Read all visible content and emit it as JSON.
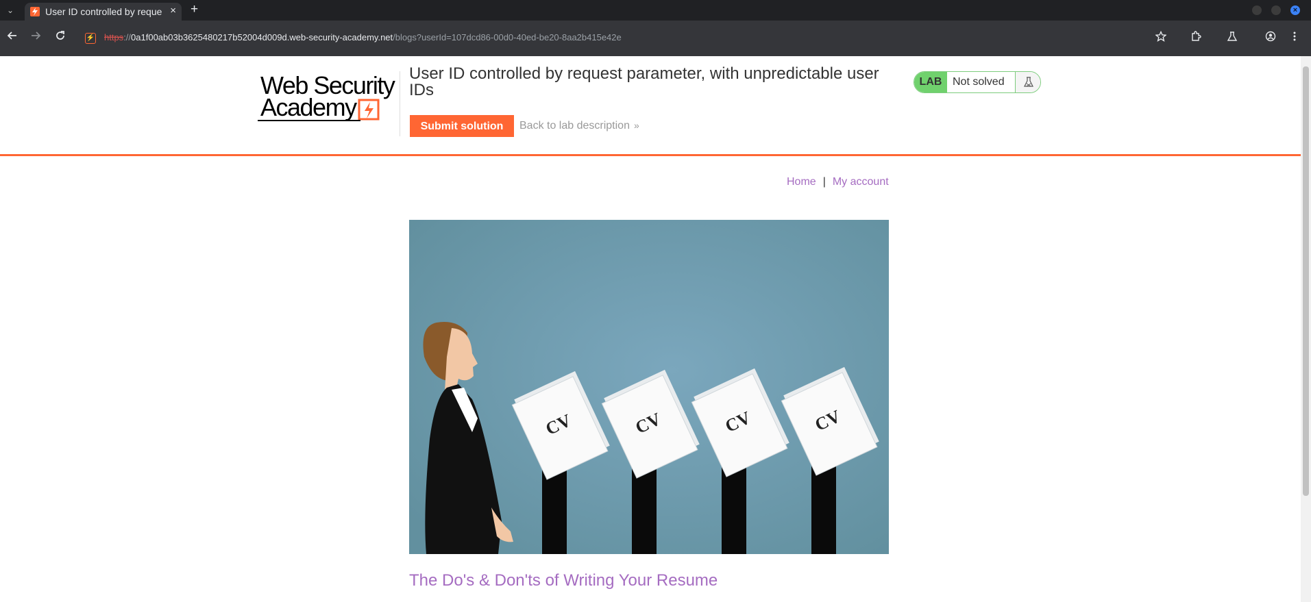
{
  "browser": {
    "tab": {
      "title": "User ID controlled by request parameter, with unpredictable user IDs",
      "close_glyph": "×"
    },
    "new_tab_glyph": "+",
    "tab_list_glyph": "⌄",
    "url": {
      "scheme": "https",
      "separator": "://",
      "host": "0a1f00ab03b3625480217b52004d009d.web-security-academy.net",
      "path": "/blogs?userId=107dcd86-00d0-40ed-be20-8aa2b415e42e"
    },
    "icons": [
      "back-icon",
      "forward-icon",
      "reload-icon",
      "bookmark-star-icon",
      "extensions-icon",
      "labs-flask-icon",
      "profile-icon",
      "menu-icon"
    ],
    "window_close_glyph": "×"
  },
  "header": {
    "logo": {
      "line1": "Web Security",
      "line2": "Academy"
    },
    "lab_title": "User ID controlled by request parameter, with unpredictable user IDs",
    "submit_label": "Submit solution",
    "back_label": "Back to lab description",
    "back_chevron": "»",
    "status": {
      "badge": "LAB",
      "text": "Not solved"
    }
  },
  "nav": {
    "home": "Home",
    "separator": "|",
    "account": "My account"
  },
  "post": {
    "image_labels": [
      "CV",
      "CV",
      "CV",
      "CV"
    ],
    "title": "The Do's & Don'ts of Writing Your Resume"
  },
  "colors": {
    "accent": "#ff6633",
    "link": "#a56cc1",
    "lab_green": "#70d16d",
    "image_bg": "#6f9db3"
  }
}
